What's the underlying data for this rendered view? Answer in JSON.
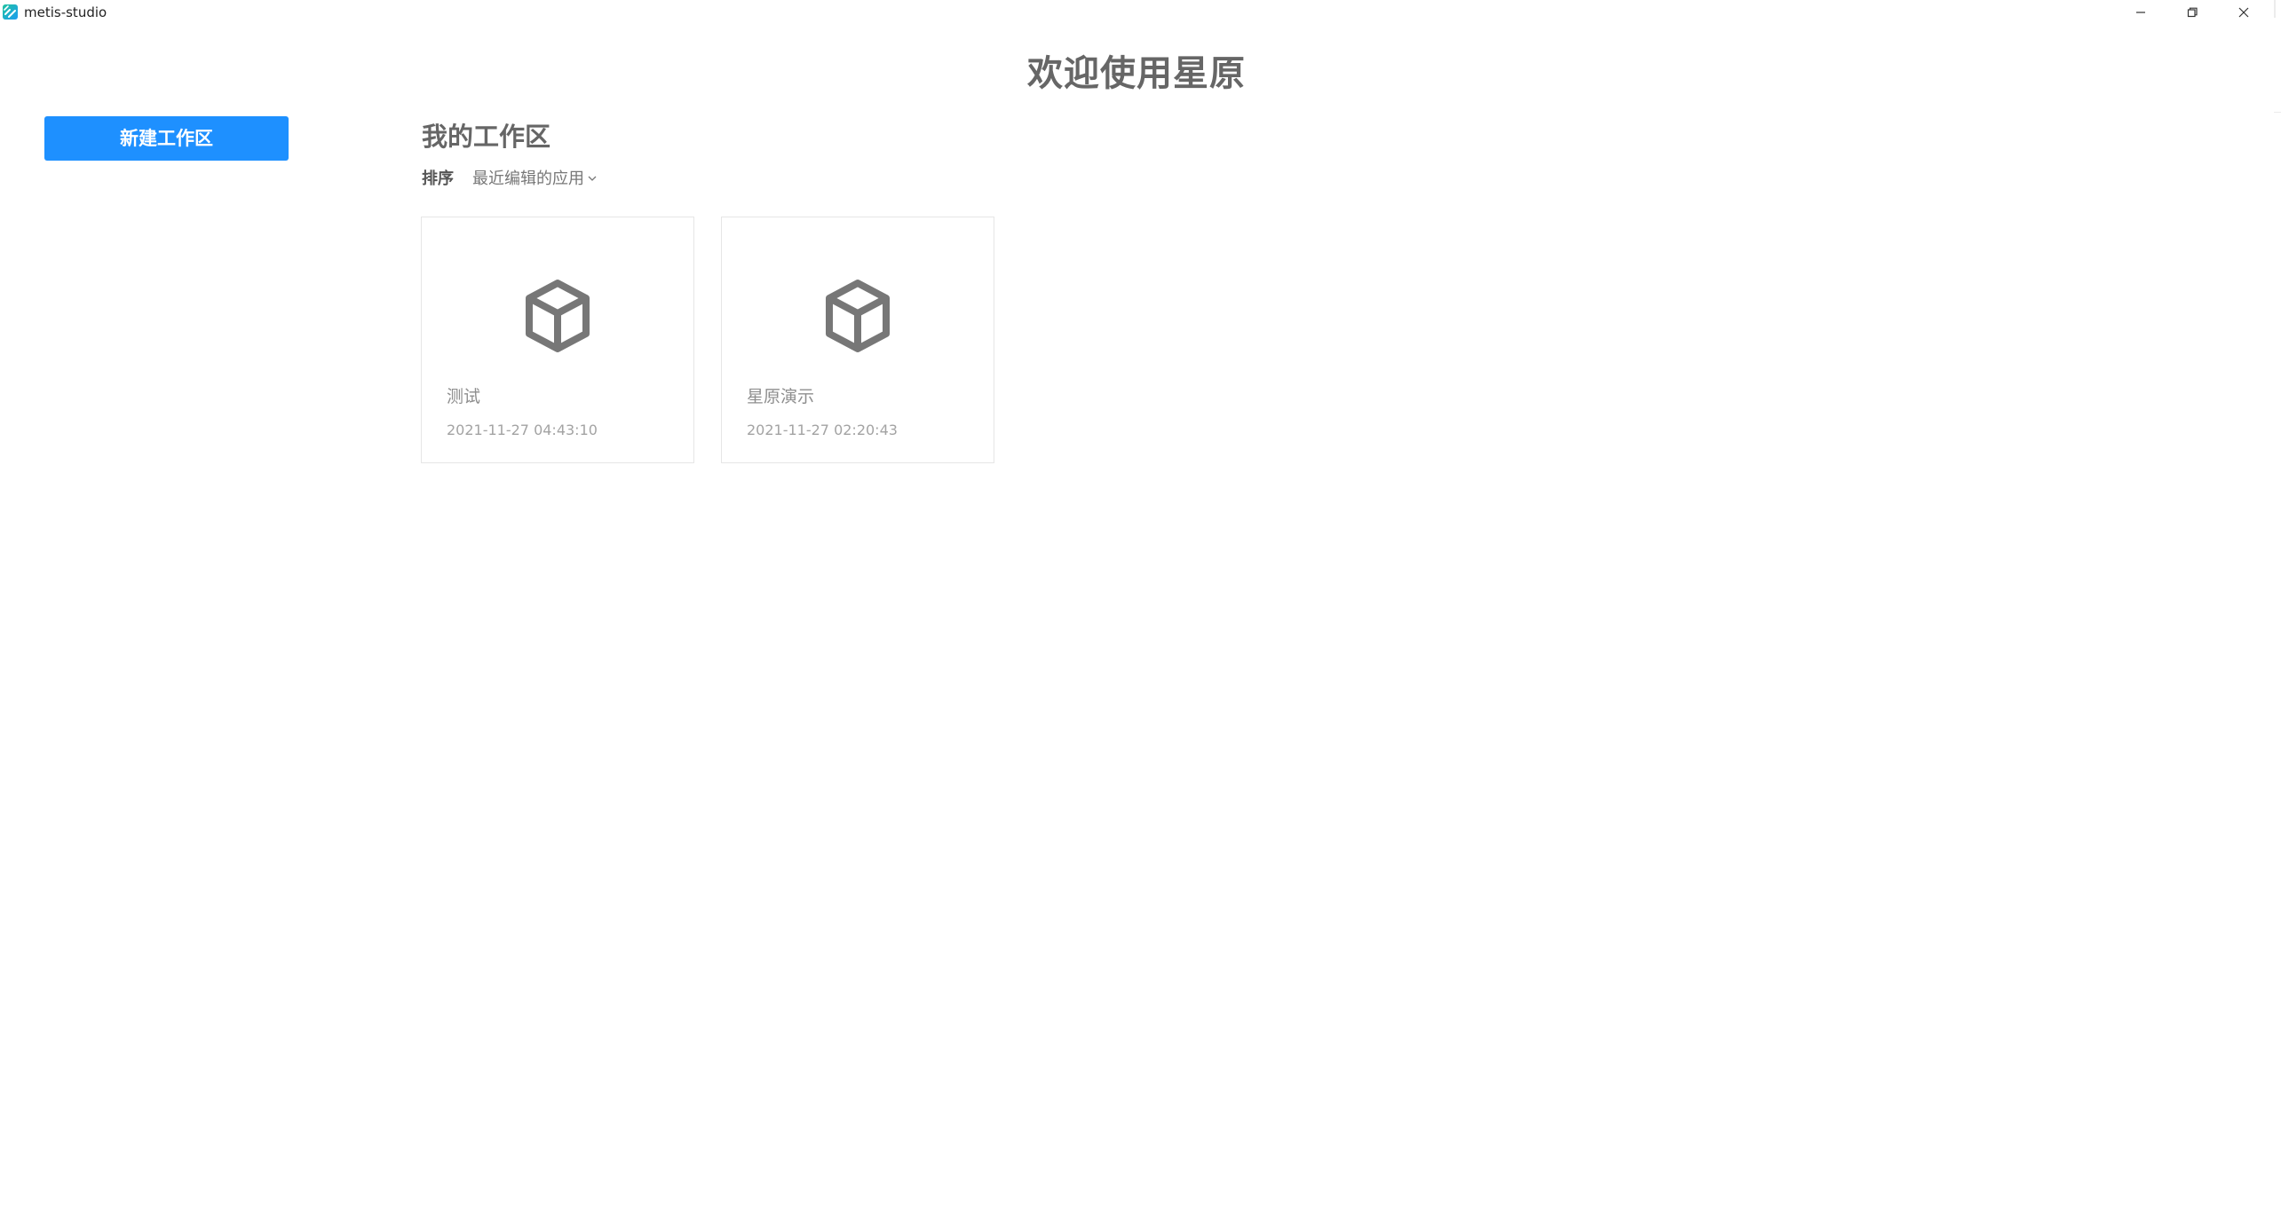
{
  "window": {
    "title": "metis-studio"
  },
  "welcome": {
    "title": "欢迎使用星原"
  },
  "sidebar": {
    "new_workspace_label": "新建工作区"
  },
  "workspaces": {
    "title": "我的工作区",
    "sort_label": "排序",
    "sort_value": "最近编辑的应用",
    "items": [
      {
        "name": "测试",
        "updated": "2021-11-27 04:43:10"
      },
      {
        "name": "星原演示",
        "updated": "2021-11-27 02:20:43"
      }
    ]
  },
  "colors": {
    "accent": "#1e90ff",
    "heading": "#666666",
    "icon": "#777777"
  },
  "icons": {
    "app": "metis-logo-icon",
    "minimize": "minimize-icon",
    "maximize": "restore-icon",
    "close": "close-icon",
    "sort_chevron": "chevron-down-icon",
    "workspace": "cube-icon"
  }
}
